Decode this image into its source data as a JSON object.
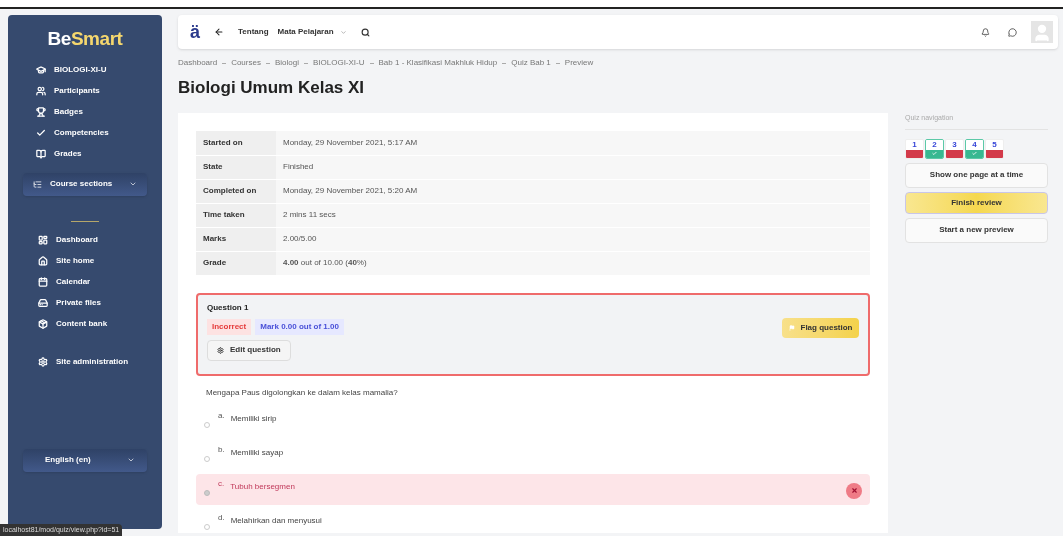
{
  "sidebar": {
    "logo": {
      "part1": "Be",
      "part2": "Smart"
    },
    "course_items": [
      {
        "label": "BIOLOGI-XI-U"
      },
      {
        "label": "Participants"
      },
      {
        "label": "Badges"
      },
      {
        "label": "Competencies"
      },
      {
        "label": "Grades"
      }
    ],
    "course_sections": {
      "label": "Course sections"
    },
    "site_items": [
      {
        "label": "Dashboard"
      },
      {
        "label": "Site home"
      },
      {
        "label": "Calendar"
      },
      {
        "label": "Private files"
      },
      {
        "label": "Content bank"
      }
    ],
    "admin_item": {
      "label": "Site administration"
    },
    "language": {
      "label": "English (en)"
    }
  },
  "topbar": {
    "logo_mark": "ä",
    "links": [
      {
        "label": "Tentang",
        "dropdown": false
      },
      {
        "label": "Mata Pelajaran",
        "dropdown": true
      }
    ]
  },
  "breadcrumb": [
    "Dashboard",
    "Courses",
    "Biologi",
    "BIOLOGI-XI-U",
    "Bab 1 - Klasifikasi Makhluk Hidup",
    "Quiz Bab 1",
    "Preview"
  ],
  "page_title": "Biologi Umum Kelas XI",
  "summary": [
    {
      "label": "Started on",
      "value": "Monday, 29 November 2021, 5:17 AM"
    },
    {
      "label": "State",
      "value": "Finished"
    },
    {
      "label": "Completed on",
      "value": "Monday, 29 November 2021, 5:20 AM"
    },
    {
      "label": "Time taken",
      "value": "2 mins 11 secs"
    },
    {
      "label": "Marks",
      "value": "2.00/5.00"
    },
    {
      "label": "Grade",
      "value": "**4.00** out of 10.00 (**40**%)"
    }
  ],
  "question": {
    "title": "Question 1",
    "status": "Incorrect",
    "mark": "Mark 0.00 out of 1.00",
    "edit_button": "Edit question",
    "flag_button": "Flag question",
    "text": "Mengapa Paus digolongkan ke dalam kelas mamalia?",
    "options": [
      {
        "letter": "a.",
        "text": "Memiliki sirip",
        "selected": false,
        "incorrect": false
      },
      {
        "letter": "b.",
        "text": "Memiliki sayap",
        "selected": false,
        "incorrect": false
      },
      {
        "letter": "c.",
        "text": "Tubuh bersegmen",
        "selected": true,
        "incorrect": true
      },
      {
        "letter": "d.",
        "text": "Melahirkan dan menyusui",
        "selected": false,
        "incorrect": false
      }
    ]
  },
  "quiz_navigation": {
    "title": "Quiz navigation",
    "items": [
      {
        "number": "1",
        "correct": false
      },
      {
        "number": "2",
        "correct": true
      },
      {
        "number": "3",
        "correct": false
      },
      {
        "number": "4",
        "correct": true
      },
      {
        "number": "5",
        "correct": false
      }
    ],
    "buttons": [
      {
        "label": "Show one page at a time",
        "kind": "plain"
      },
      {
        "label": "Finish review",
        "kind": "primary"
      },
      {
        "label": "Start a new preview",
        "kind": "plain"
      }
    ]
  },
  "status_url": "localhost81/mod/quiz/view.php?id=51"
}
